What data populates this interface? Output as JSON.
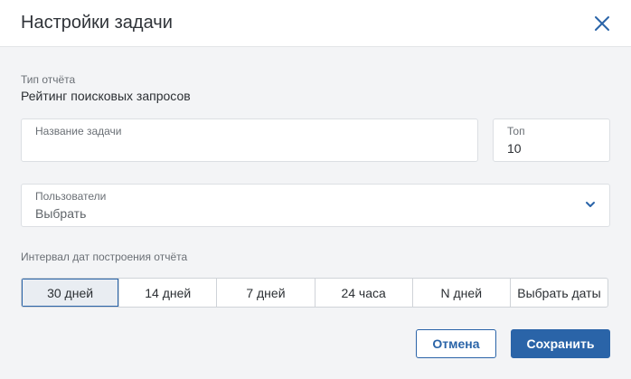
{
  "dialog": {
    "title": "Настройки задачи",
    "close_icon": "close-icon"
  },
  "report_type": {
    "label": "Тип отчёта",
    "value": "Рейтинг поисковых запросов"
  },
  "task_name": {
    "label": "Название задачи",
    "value": ""
  },
  "top": {
    "label": "Топ",
    "value": "10"
  },
  "users": {
    "label": "Пользователи",
    "value": "Выбрать",
    "icon": "chevron-down-icon"
  },
  "interval": {
    "label": "Интервал дат построения отчёта",
    "options": [
      "30 дней",
      "14 дней",
      "7 дней",
      "24 часа",
      "N дней",
      "Выбрать даты"
    ],
    "selected": "30 дней"
  },
  "buttons": {
    "cancel": "Отмена",
    "save": "Сохранить"
  },
  "colors": {
    "accent": "#2a64a8",
    "background": "#f3f4f6"
  }
}
